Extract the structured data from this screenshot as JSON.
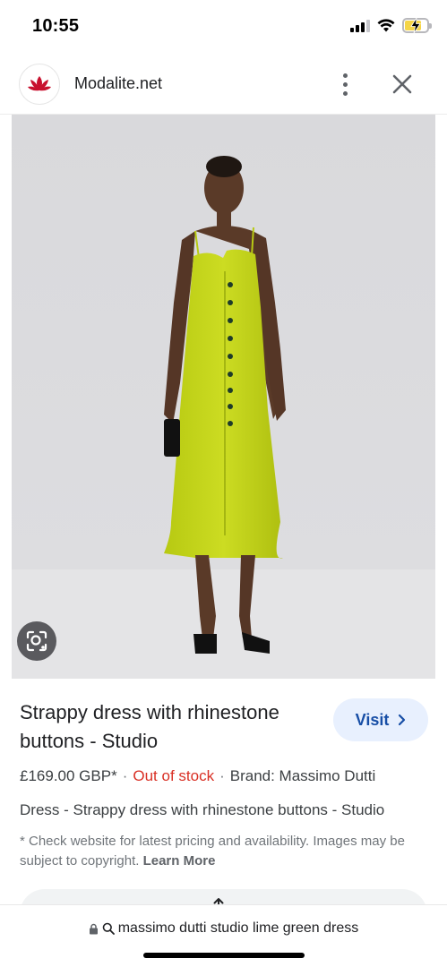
{
  "status_bar": {
    "time": "10:55",
    "icons": [
      "cellular-signal-icon",
      "wifi-icon",
      "battery-charging-icon"
    ]
  },
  "header": {
    "site_name": "Modalite.net",
    "logo_icon": "lotus-logo-icon",
    "menu_icon": "more-vertical-icon",
    "close_icon": "close-icon"
  },
  "product": {
    "image_description_icon": "lens-search-icon",
    "title": "Strappy dress with rhinestone buttons - Studio",
    "visit_label": "Visit",
    "price": "£169.00 GBP*",
    "separator": "·",
    "availability": "Out of stock",
    "brand": "Brand: Massimo Dutti",
    "description": "Dress - Strappy dress with rhinestone buttons - Studio",
    "disclaimer": "* Check website for latest pricing and availability. Images may be subject to copyright.",
    "learn_more": "Learn More",
    "share_label": "Share"
  },
  "url_bar": {
    "query": "massimo dutti studio lime green dress"
  },
  "colors": {
    "dress": "#c6d81c",
    "out_of_stock": "#d93025",
    "visit_bg": "#e8f0fe",
    "visit_text": "#174ea6",
    "logo_red": "#c8102e"
  }
}
